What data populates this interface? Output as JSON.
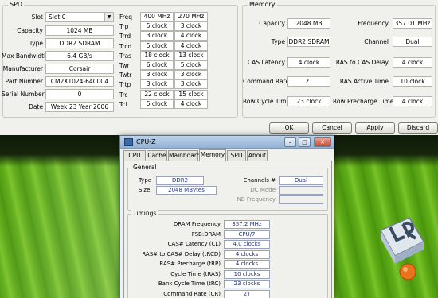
{
  "spd": {
    "title": "SPD",
    "slot_label": "Slot",
    "slot_value": "Slot 0",
    "rows": [
      {
        "label": "Capacity",
        "value": "1024 MB"
      },
      {
        "label": "Type",
        "value": "DDR2 SDRAM"
      },
      {
        "label": "Max Bandwidth",
        "value": "6.4 GB/s"
      },
      {
        "label": "Manufacturer",
        "value": "Corsair"
      },
      {
        "label": "Part Number",
        "value": "CM2X1024-6400C4"
      },
      {
        "label": "Serial Number",
        "value": "0"
      },
      {
        "label": "Date",
        "value": "Week 23 Year 2006"
      }
    ],
    "timing_rows": [
      {
        "label": "Freq",
        "a": "400 MHz",
        "b": "270 MHz"
      },
      {
        "label": "Trp",
        "a": "5 clock",
        "b": "3 clock"
      },
      {
        "label": "Trrd",
        "a": "3 clock",
        "b": "4 clock"
      },
      {
        "label": "Trcd",
        "a": "5 clock",
        "b": "4 clock"
      },
      {
        "label": "Tras",
        "a": "18 clock",
        "b": "13 clock"
      },
      {
        "label": "Twr",
        "a": "6 clock",
        "b": "5 clock"
      },
      {
        "label": "Twtr",
        "a": "3 clock",
        "b": "3 clock"
      },
      {
        "label": "Trtp",
        "a": "3 clock",
        "b": "3 clock"
      },
      {
        "label": "Trc",
        "a": "22 clock",
        "b": "15 clock"
      },
      {
        "label": "Tcl",
        "a": "5 clock",
        "b": "4 clock"
      }
    ]
  },
  "memory": {
    "title": "Memory",
    "left": [
      {
        "label": "Capacity",
        "value": "2048 MB"
      },
      {
        "label": "Type",
        "value": "DDR2 SDRAM"
      },
      {
        "label": "CAS Latency",
        "value": "4 clock"
      },
      {
        "label": "Command Rate",
        "value": "2T"
      },
      {
        "label": "Row Cycle Time",
        "value": "23 clock"
      }
    ],
    "right": [
      {
        "label": "Frequency",
        "value": "357.01 MHz"
      },
      {
        "label": "Channel",
        "value": "Dual"
      },
      {
        "label": "RAS to CAS Delay",
        "value": "4 clock"
      },
      {
        "label": "RAS Active Time",
        "value": "10 clock"
      },
      {
        "label": "Row Precharge Time",
        "value": "4 clock"
      }
    ]
  },
  "buttons": {
    "ok": "OK",
    "cancel": "Cancel",
    "apply": "Apply",
    "discard": "Discard"
  },
  "cpuz": {
    "title": "CPU-Z",
    "minimize": "–",
    "maximize": "□",
    "close": "✕",
    "tabs": [
      "CPU",
      "Cache",
      "Mainboard",
      "Memory",
      "SPD",
      "About"
    ],
    "active_tab": "Memory",
    "general": {
      "title": "General",
      "type_label": "Type",
      "type_value": "DDR2",
      "size_label": "Size",
      "size_value": "2048 MBytes",
      "channels_label": "Channels #",
      "channels_value": "Dual",
      "dcmode_label": "DC Mode",
      "dcmode_value": "",
      "nbfreq_label": "NB Frequency",
      "nbfreq_value": ""
    },
    "timings": {
      "title": "Timings",
      "rows": [
        {
          "label": "DRAM Frequency",
          "value": "357.2 MHz"
        },
        {
          "label": "FSB:DRAM",
          "value": "CPU/7"
        },
        {
          "label": "CAS# Latency (CL)",
          "value": "4.0 clocks"
        },
        {
          "label": "RAS# to CAS# Delay (tRCD)",
          "value": "4 clocks"
        },
        {
          "label": "RAS# Precharge (tRP)",
          "value": "4 clocks"
        },
        {
          "label": "Cycle Time (tRAS)",
          "value": "10 clocks"
        },
        {
          "label": "Bank Cycle Time (tRC)",
          "value": "23 clocks"
        },
        {
          "label": "Command Rate (CR)",
          "value": "2T"
        }
      ]
    }
  },
  "colors": {
    "accent": "#21307a",
    "desktop_green": "#5fae17",
    "logo_orange": "#e8731a"
  },
  "icons": [
    "combo-arrow-icon",
    "cpuz-app-icon",
    "minimize-icon",
    "maximize-icon",
    "close-icon",
    "lr-logo"
  ]
}
